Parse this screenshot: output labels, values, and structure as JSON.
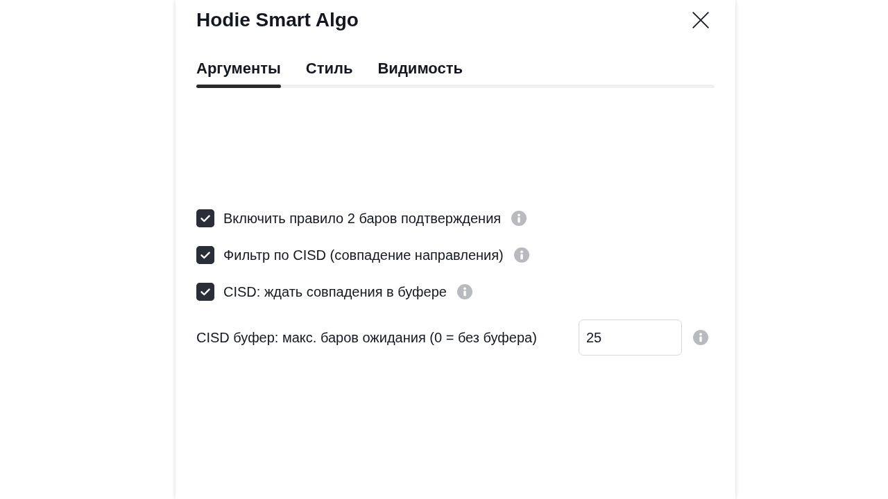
{
  "dialog": {
    "title": "Hodie Smart Algo"
  },
  "tabs": [
    {
      "label": "Аргументы",
      "selected": true
    },
    {
      "label": "Стиль",
      "selected": false
    },
    {
      "label": "Видимость",
      "selected": false
    }
  ],
  "arguments": [
    {
      "kind": "checkbox",
      "label": "Включить правило 2 баров подтверждения",
      "checked": true
    },
    {
      "kind": "checkbox",
      "label": "Фильтр по CISD (совпадение направления)",
      "checked": true
    },
    {
      "kind": "checkbox",
      "label": "CISD: ждать совпадения в буфере",
      "checked": true
    },
    {
      "kind": "number",
      "label": "CISD буфер: макс. баров ожидания (0 = без буфера)",
      "value": "25"
    }
  ]
}
